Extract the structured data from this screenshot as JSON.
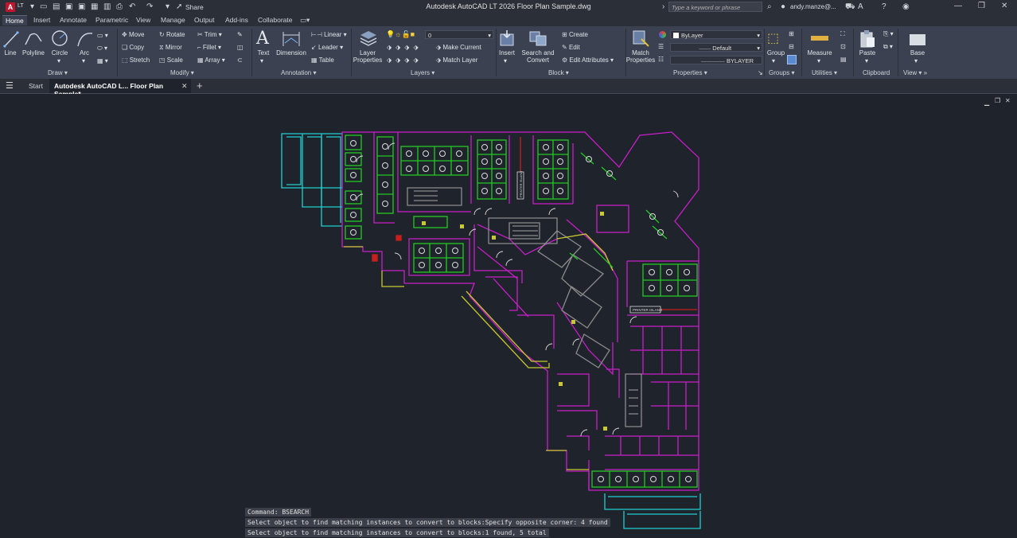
{
  "app": {
    "logo_text": "A",
    "edition": "LT",
    "title": "Autodesk AutoCAD LT 2026   Floor Plan Sample.dwg",
    "share_label": "Share",
    "search_placeholder": "Type a keyword or phrase",
    "user_label": "andy.manze@..."
  },
  "ribbon_tabs": [
    "Home",
    "Insert",
    "Annotate",
    "Parametric",
    "View",
    "Manage",
    "Output",
    "Add-ins",
    "Collaborate"
  ],
  "draw": {
    "line": "Line",
    "polyline": "Polyline",
    "circle": "Circle",
    "arc": "Arc",
    "panel": "Draw"
  },
  "modify": {
    "move": "Move",
    "rotate": "Rotate",
    "trim": "Trim",
    "copy": "Copy",
    "mirror": "Mirror",
    "fillet": "Fillet",
    "stretch": "Stretch",
    "scale": "Scale",
    "array": "Array",
    "panel": "Modify"
  },
  "annotation": {
    "text": "Text",
    "dimension": "Dimension",
    "linear": "Linear",
    "leader": "Leader",
    "table": "Table",
    "panel": "Annotation"
  },
  "layers": {
    "layer_properties": "Layer\nProperties",
    "current_layer": "0",
    "make_current": "Make Current",
    "match_layer": "Match Layer",
    "panel": "Layers"
  },
  "block": {
    "insert": "Insert",
    "search_convert": "Search and\nConvert",
    "create": "Create",
    "edit": "Edit",
    "edit_attributes": "Edit Attributes",
    "panel": "Block"
  },
  "properties": {
    "match": "Match\nProperties",
    "color": "ByLayer",
    "linetype": "Default",
    "lineweight": "BYLAYER",
    "panel": "Properties"
  },
  "groups": {
    "group": "Group",
    "panel": "Groups"
  },
  "utilities": {
    "measure": "Measure",
    "panel": "Utilities"
  },
  "clipboard": {
    "paste": "Paste",
    "panel": "Clipboard"
  },
  "view": {
    "base": "Base",
    "panel": "View"
  },
  "doc_tabs": {
    "start": "Start",
    "active": "Autodesk AutoCAD L... Floor Plan Sample*"
  },
  "drawing": {
    "label_1": "PRINTER ISLAND",
    "label_2": "PRINTER ISLAND"
  },
  "command_history": [
    "Command: BSEARCH",
    "Select object to find matching instances to convert to blocks:Specify opposite corner: 4 found",
    "Select object to find matching instances to convert to blocks:1 found, 5 total"
  ],
  "colors": {
    "magenta": "#c81ec8",
    "cyan": "#1ed2d2",
    "green": "#23c823",
    "yellow": "#c8c832",
    "white": "#dcdcdc",
    "red": "#c81e1e",
    "gray": "#8c8c8c"
  }
}
